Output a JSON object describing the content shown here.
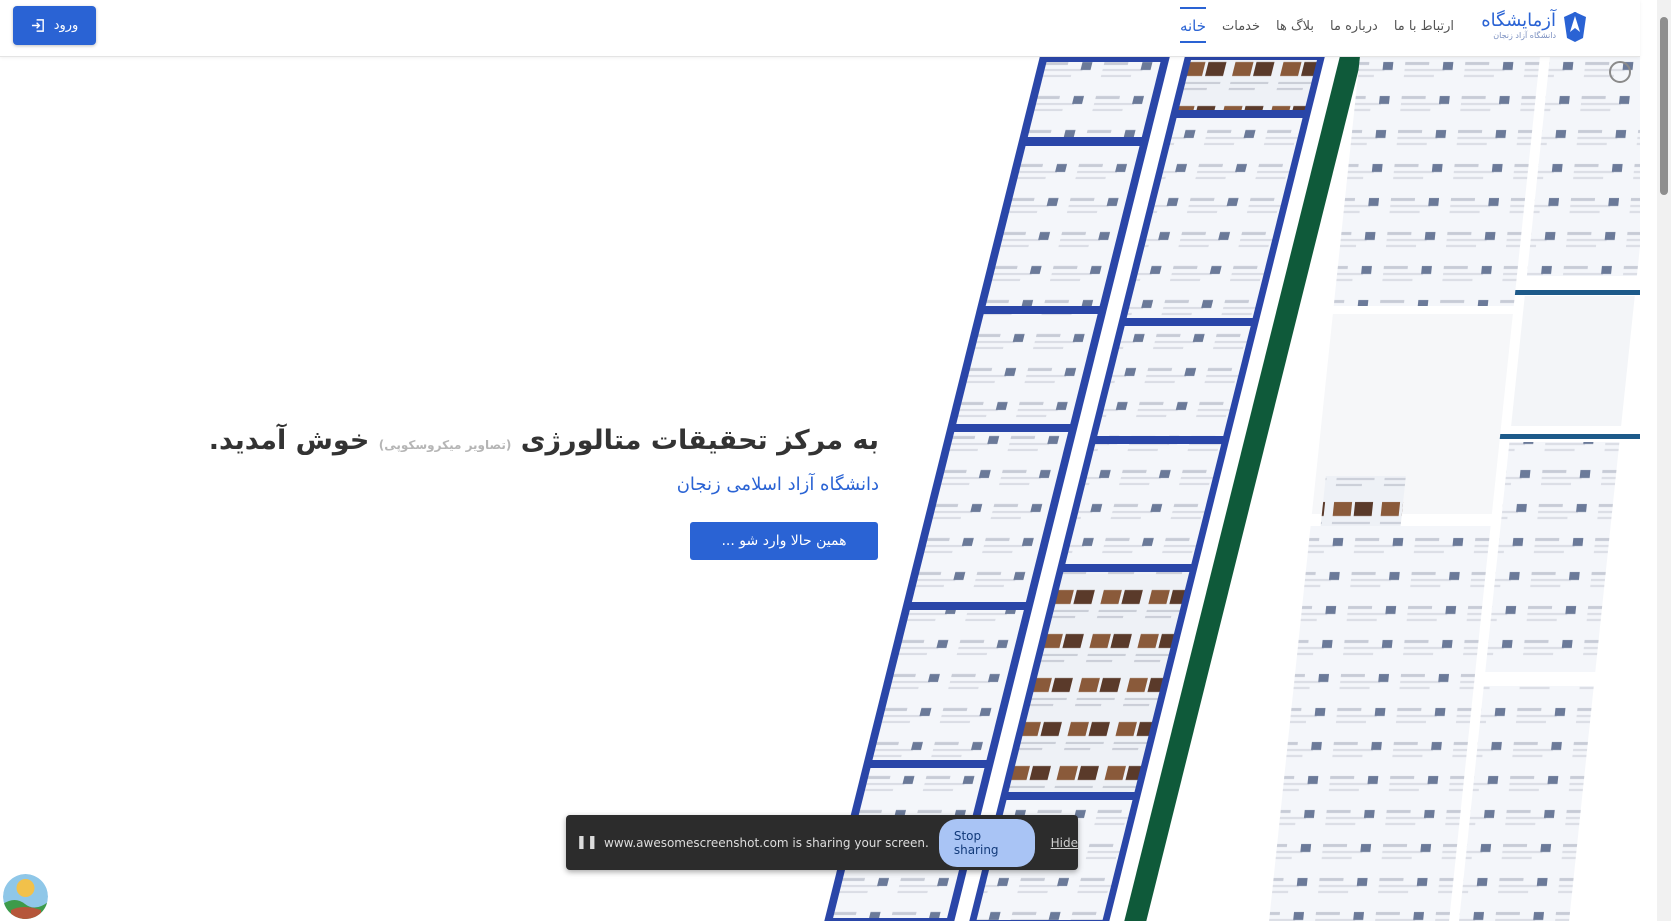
{
  "navbar": {
    "login_label": "ورود",
    "links": [
      "خانه",
      "خدمات",
      "بلاگ ها",
      "درباره ما",
      "ارتباط با ما"
    ],
    "active_index": 0,
    "brand_name": "آزمایشگاه",
    "brand_subtitle": "دانشگاه آزاد زنجان"
  },
  "hero": {
    "title_start": "به مرکز تحقیقات متالورژی",
    "title_sub": "(تصاویر میکروسکوپی)",
    "title_end": "خوش آمدید.",
    "subtitle": "دانشگاه آزاد اسلامی زنجان",
    "cta_label": "همین حالا وارد شو ..."
  },
  "share_bar": {
    "message": "www.awesomescreenshot.com is sharing your screen.",
    "stop_label": "Stop sharing",
    "hide_label": "Hide"
  },
  "colors": {
    "primary": "#2a63d4",
    "collage_blue": "#2a46a8",
    "collage_green": "#0f5a3a",
    "share_bg": "#2c2c2c"
  },
  "icons": {
    "login": "login-icon",
    "brand": "university-logo-icon",
    "pause": "pause-icon",
    "avatar": "avatar-icon"
  }
}
